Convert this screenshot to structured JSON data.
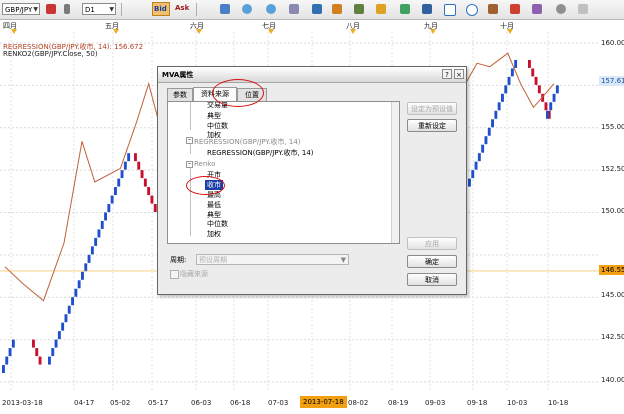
{
  "toolbar": {
    "symbol": "GBP/JPY",
    "timeframe": "D1",
    "bid_label": "Bid",
    "ask_label": "Ask",
    "icons": [
      "flag-icon",
      "dropdown-icon",
      "gear-icon",
      "bid-ask-icon",
      "crosshair-icon",
      "zoom-in-icon",
      "zoom-out-icon",
      "grid-icon",
      "chart-type-icon",
      "indicator-icon",
      "line-draw-icon",
      "text-icon",
      "image-icon",
      "save-icon",
      "rectangle-icon",
      "ellipse-icon",
      "pencil-icon",
      "settings-icon"
    ]
  },
  "months": [
    "四月",
    "五月",
    "六月",
    "七月",
    "八月",
    "九月",
    "十月"
  ],
  "indicators": {
    "regression": "REGRESSION(GBP/JPY.收市, 14): 156.672",
    "renko": "RENKO2(GBP/JPY.Close, 50)"
  },
  "y_axis": {
    "labels": [
      "160.00",
      "157.50",
      "155.00",
      "152.50",
      "150.00",
      "147.50",
      "145.00",
      "142.50",
      "140.00"
    ],
    "current_regression": "157.61",
    "current_price": "146.55"
  },
  "x_axis": {
    "labels": [
      "2013-03-18",
      "04-17",
      "05-02",
      "05-17",
      "06-03",
      "06-18",
      "07-03",
      "2013-07-18",
      "08-02",
      "08-19",
      "09-03",
      "09-18",
      "10-03",
      "10-18"
    ],
    "highlight": "2013-07-18"
  },
  "colors": {
    "up": "#1f4fcc",
    "down": "#c8102e",
    "regression": "#c0603a",
    "accent": "#f0a010"
  },
  "dialog": {
    "title": "MVA属性",
    "tabs": [
      "参数",
      "资料来源",
      "位置"
    ],
    "active_tab": "资料来源",
    "tree": [
      {
        "label": "交易量",
        "indent": 2,
        "grey": false
      },
      {
        "label": "典型",
        "indent": 2,
        "grey": false
      },
      {
        "label": "中位数",
        "indent": 2,
        "grey": false
      },
      {
        "label": "加权",
        "indent": 2,
        "grey": false
      },
      {
        "label": "REGRESSION(GBP/JPY.收市, 14)",
        "indent": 1,
        "grey": true
      },
      {
        "label": "REGRESSION(GBP/JPY.收市, 14)",
        "indent": 2,
        "grey": false
      },
      {
        "label": "Renko",
        "indent": 1,
        "grey": true
      },
      {
        "label": "开市",
        "indent": 2,
        "grey": false
      },
      {
        "label": "收市",
        "indent": 2,
        "grey": false,
        "selected": true
      },
      {
        "label": "最高",
        "indent": 2,
        "grey": false
      },
      {
        "label": "最低",
        "indent": 2,
        "grey": false
      },
      {
        "label": "典型",
        "indent": 2,
        "grey": false
      },
      {
        "label": "中位数",
        "indent": 2,
        "grey": false
      },
      {
        "label": "加权",
        "indent": 2,
        "grey": false
      }
    ],
    "buttons": {
      "set_default": "设定为预设值",
      "reset": "重新设定",
      "apply": "应用",
      "ok": "确定",
      "cancel": "取消"
    },
    "period_label": "周期:",
    "period_value": "预设周期",
    "hidden_source_label": "隐藏来源"
  },
  "chart_data": {
    "type": "renko",
    "brick_size": 0.5,
    "ylim": [
      140,
      160
    ],
    "segments": [
      {
        "direction": "up",
        "from": 140.5,
        "to": 142.5
      },
      {
        "direction": "down",
        "from": 142.5,
        "to": 141.0
      },
      {
        "direction": "up",
        "from": 141.0,
        "to": 153.5
      },
      {
        "direction": "down",
        "from": 153.5,
        "to": 150.0
      },
      {
        "direction": "up",
        "from": 151.5,
        "to": 159.0
      },
      {
        "direction": "down",
        "from": 159.0,
        "to": 155.5
      },
      {
        "direction": "up",
        "from": 155.5,
        "to": 157.5
      }
    ],
    "regression_line": [
      {
        "date": "2013-03-18",
        "value": 146.8
      },
      {
        "date": "2013-03-25",
        "value": 145.8
      },
      {
        "date": "2013-04-02",
        "value": 144.8
      },
      {
        "date": "2013-04-10",
        "value": 148.2
      },
      {
        "date": "2013-04-17",
        "value": 154.2
      },
      {
        "date": "2013-04-22",
        "value": 151.8
      },
      {
        "date": "2013-05-02",
        "value": 152.6
      },
      {
        "date": "2013-05-08",
        "value": 155.2
      },
      {
        "date": "2013-05-13",
        "value": 157.6
      },
      {
        "date": "2013-05-20",
        "value": 153.6
      },
      {
        "date": "2013-05-27",
        "value": 150.6
      },
      {
        "date": "2013-09-05",
        "value": 154.8
      },
      {
        "date": "2013-09-12",
        "value": 157.2
      },
      {
        "date": "2013-09-18",
        "value": 158.8
      },
      {
        "date": "2013-09-23",
        "value": 158.6
      },
      {
        "date": "2013-09-30",
        "value": 159.4
      },
      {
        "date": "2013-10-05",
        "value": 157.6
      },
      {
        "date": "2013-10-10",
        "value": 156.2
      },
      {
        "date": "2013-10-18",
        "value": 157.6
      }
    ]
  }
}
